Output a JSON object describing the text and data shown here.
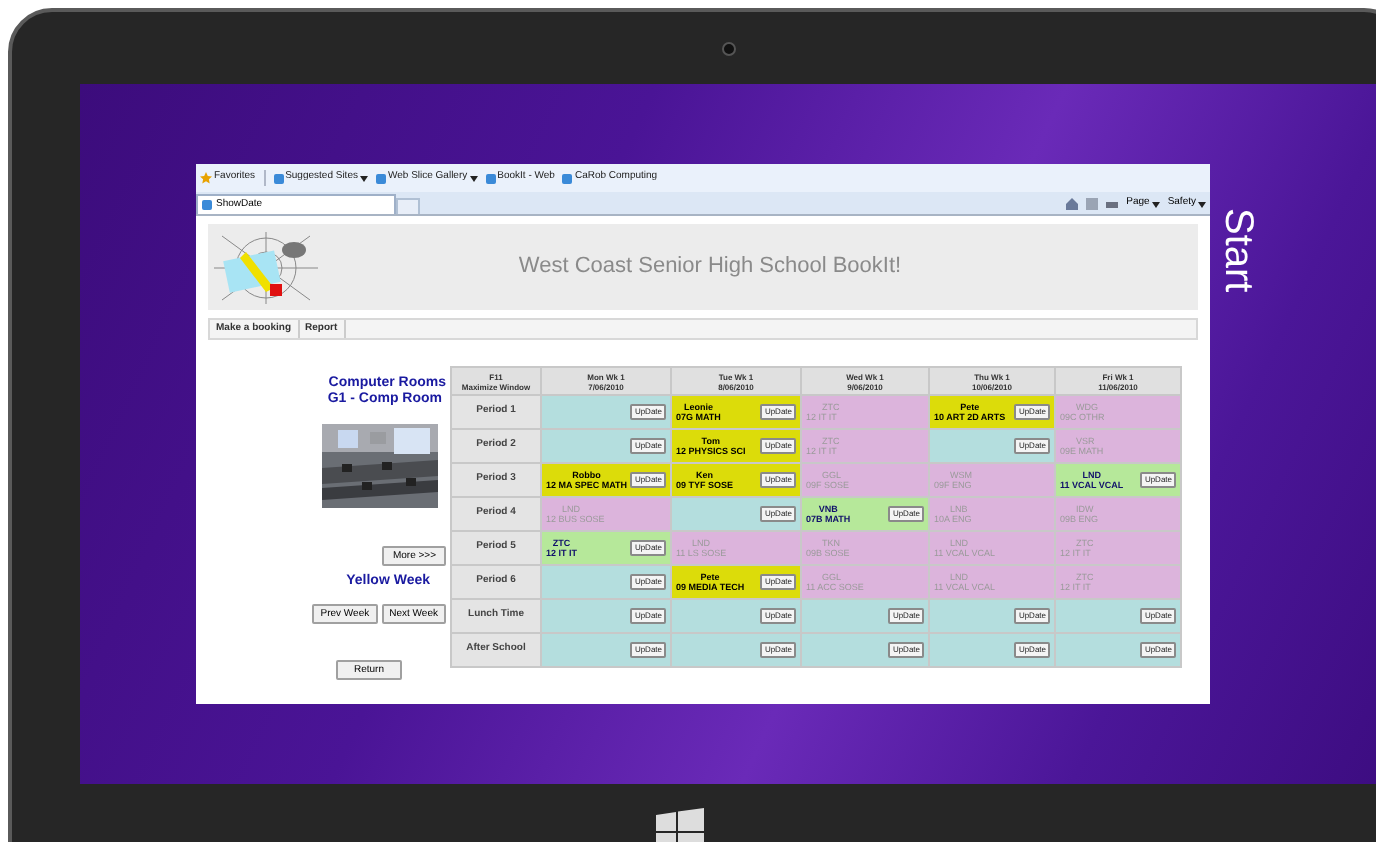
{
  "side_label": "Start",
  "browser": {
    "favorites": "Favorites",
    "links": [
      {
        "label": "Suggested Sites",
        "dropdown": true
      },
      {
        "label": "Web Slice Gallery",
        "dropdown": true
      },
      {
        "label": "BookIt - Web",
        "dropdown": false
      },
      {
        "label": "CaRob Computing",
        "dropdown": false
      }
    ],
    "tab": "ShowDate",
    "commands": [
      "Page",
      "Safety"
    ]
  },
  "page": {
    "title": "West Coast Senior High School BookIt!",
    "nav": [
      {
        "label": "Make a booking"
      },
      {
        "label": "Report"
      }
    ],
    "room_category": "Computer Rooms",
    "room_name": "G1 - Comp Room",
    "more_button": "More >>>",
    "week": "Yellow Week",
    "prev_button": "Prev Week",
    "next_button": "Next Week",
    "return_button": "Return"
  },
  "table": {
    "corner": [
      "F11",
      "Maximize Window"
    ],
    "days": [
      {
        "day": "Mon Wk 1",
        "date": "7/06/2010"
      },
      {
        "day": "Tue Wk 1",
        "date": "8/06/2010"
      },
      {
        "day": "Wed Wk 1",
        "date": "9/06/2010"
      },
      {
        "day": "Thu Wk 1",
        "date": "10/06/2010"
      },
      {
        "day": "Fri Wk 1",
        "date": "11/06/2010"
      }
    ],
    "rows": [
      {
        "period": "Period 1",
        "cells": [
          {
            "kind": "free",
            "button": "UpDate"
          },
          {
            "kind": "booked",
            "who": "Leonie",
            "what": "07G MATH",
            "button": "UpDate"
          },
          {
            "kind": "taken",
            "who": "ZTC",
            "what": "12 IT IT"
          },
          {
            "kind": "booked",
            "who": "Pete",
            "what": "10 ART 2D ARTS",
            "button": "UpDate"
          },
          {
            "kind": "taken",
            "who": "WDG",
            "what": "09C OTHR"
          }
        ]
      },
      {
        "period": "Period 2",
        "cells": [
          {
            "kind": "free",
            "button": "UpDate"
          },
          {
            "kind": "booked",
            "who": "Tom",
            "what": "12 PHYSICS SCI",
            "button": "UpDate"
          },
          {
            "kind": "taken",
            "who": "ZTC",
            "what": "12 IT IT"
          },
          {
            "kind": "free",
            "button": "UpDate"
          },
          {
            "kind": "taken",
            "who": "VSR",
            "what": "09E MATH"
          }
        ]
      },
      {
        "period": "Period 3",
        "cells": [
          {
            "kind": "booked",
            "who": "Robbo",
            "what": "12 MA SPEC MATH",
            "button": "UpDate"
          },
          {
            "kind": "booked",
            "who": "Ken",
            "what": "09 TYF SOSE",
            "button": "UpDate"
          },
          {
            "kind": "taken",
            "who": "GGL",
            "what": "09F SOSE"
          },
          {
            "kind": "taken",
            "who": "WSM",
            "what": "09F ENG"
          },
          {
            "kind": "own",
            "who": "LND",
            "what": "11 VCAL VCAL",
            "button": "UpDate"
          }
        ]
      },
      {
        "period": "Period 4",
        "cells": [
          {
            "kind": "taken",
            "who": "LND",
            "what": "12 BUS SOSE"
          },
          {
            "kind": "free",
            "button": "UpDate"
          },
          {
            "kind": "own",
            "who": "VNB",
            "what": "07B MATH",
            "button": "UpDate"
          },
          {
            "kind": "taken",
            "who": "LNB",
            "what": "10A ENG"
          },
          {
            "kind": "taken",
            "who": "IDW",
            "what": "09B ENG"
          }
        ]
      },
      {
        "period": "Period 5",
        "cells": [
          {
            "kind": "own",
            "who": "ZTC",
            "what": "12 IT IT",
            "button": "UpDate"
          },
          {
            "kind": "taken",
            "who": "LND",
            "what": "11 LS SOSE"
          },
          {
            "kind": "taken",
            "who": "TKN",
            "what": "09B SOSE"
          },
          {
            "kind": "taken",
            "who": "LND",
            "what": "11 VCAL VCAL"
          },
          {
            "kind": "taken",
            "who": "ZTC",
            "what": "12 IT IT"
          }
        ]
      },
      {
        "period": "Period 6",
        "cells": [
          {
            "kind": "free",
            "button": "UpDate"
          },
          {
            "kind": "booked",
            "who": "Pete",
            "what": "09 MEDIA TECH",
            "button": "UpDate"
          },
          {
            "kind": "taken",
            "who": "GGL",
            "what": "11 ACC SOSE"
          },
          {
            "kind": "taken",
            "who": "LND",
            "what": "11 VCAL VCAL"
          },
          {
            "kind": "taken",
            "who": "ZTC",
            "what": "12 IT IT"
          }
        ]
      },
      {
        "period": "Lunch Time",
        "cells": [
          {
            "kind": "free",
            "button": "UpDate"
          },
          {
            "kind": "free",
            "button": "UpDate"
          },
          {
            "kind": "free",
            "button": "UpDate"
          },
          {
            "kind": "free",
            "button": "UpDate"
          },
          {
            "kind": "free",
            "button": "UpDate"
          }
        ]
      },
      {
        "period": "After School",
        "cells": [
          {
            "kind": "free",
            "button": "UpDate"
          },
          {
            "kind": "free",
            "button": "UpDate"
          },
          {
            "kind": "free",
            "button": "UpDate"
          },
          {
            "kind": "free",
            "button": "UpDate"
          },
          {
            "kind": "free",
            "button": "UpDate"
          }
        ]
      }
    ]
  }
}
